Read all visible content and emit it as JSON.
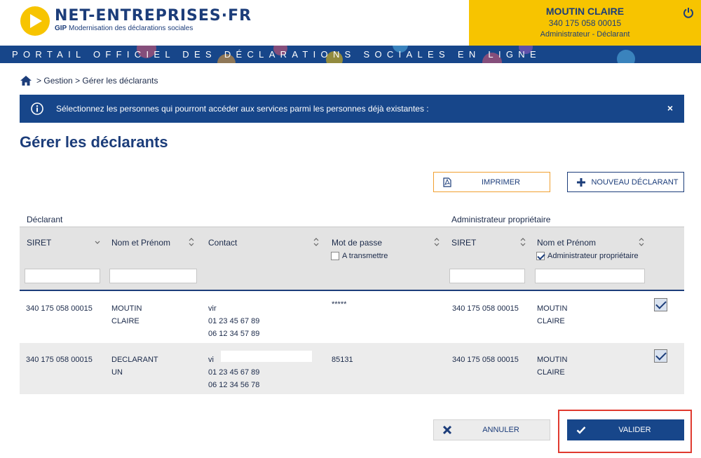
{
  "header": {
    "logo_title": "NET-ENTREPRISES·FR",
    "logo_sub_bold": "GIP",
    "logo_sub": "Modernisation des déclarations sociales",
    "user_name": "MOUTIN CLAIRE",
    "user_siret": "340 175 058 00015",
    "user_role": "Administrateur - Déclarant",
    "banner": "PORTAIL OFFICIEL DES DÉCLARATIONS SOCIALES EN LIGNE"
  },
  "breadcrumb": {
    "items": [
      "Gestion",
      "Gérer les déclarants"
    ],
    "sep": ">"
  },
  "alert": {
    "text": "Sélectionnez les personnes qui pourront accéder aux services parmi les personnes déjà existantes :",
    "close": "×"
  },
  "page_title": "Gérer les déclarants",
  "toolbar": {
    "print_label": "IMPRIMER",
    "new_label": "NOUVEAU DÉCLARANT"
  },
  "table": {
    "group_declarant": "Déclarant",
    "group_admin": "Administrateur propriétaire",
    "columns": {
      "siret": "SIRET",
      "nom": "Nom et Prénom",
      "contact": "Contact",
      "mdp": "Mot de passe",
      "admin_siret": "SIRET",
      "admin_nom": "Nom et Prénom"
    },
    "filter_mdp_label": "A transmettre",
    "filter_admin_label": "Administrateur propriétaire",
    "rows": [
      {
        "siret": "340 175 058 00015",
        "nom1": "MOUTIN",
        "nom2": "CLAIRE",
        "contact_email": "vir",
        "phone1": "01 23 45 67 89",
        "phone2": "06 12 34 57 89",
        "mdp": "*****",
        "admin_siret": "340 175 058 00015",
        "admin_nom1": "MOUTIN",
        "admin_nom2": "CLAIRE"
      },
      {
        "siret": "340 175 058 00015",
        "nom1": "DECLARANT",
        "nom2": "UN",
        "contact_email": "vi",
        "phone1": "01 23 45 67 89",
        "phone2": "06 12 34 56 78",
        "mdp": "85131",
        "admin_siret": "340 175 058 00015",
        "admin_nom1": "MOUTIN",
        "admin_nom2": "CLAIRE"
      }
    ]
  },
  "actions": {
    "cancel_label": "ANNULER",
    "validate_label": "VALIDER"
  },
  "colors": {
    "brand_blue": "#17468a",
    "brand_yellow": "#f7c400",
    "highlight_red": "#e03a2f"
  }
}
